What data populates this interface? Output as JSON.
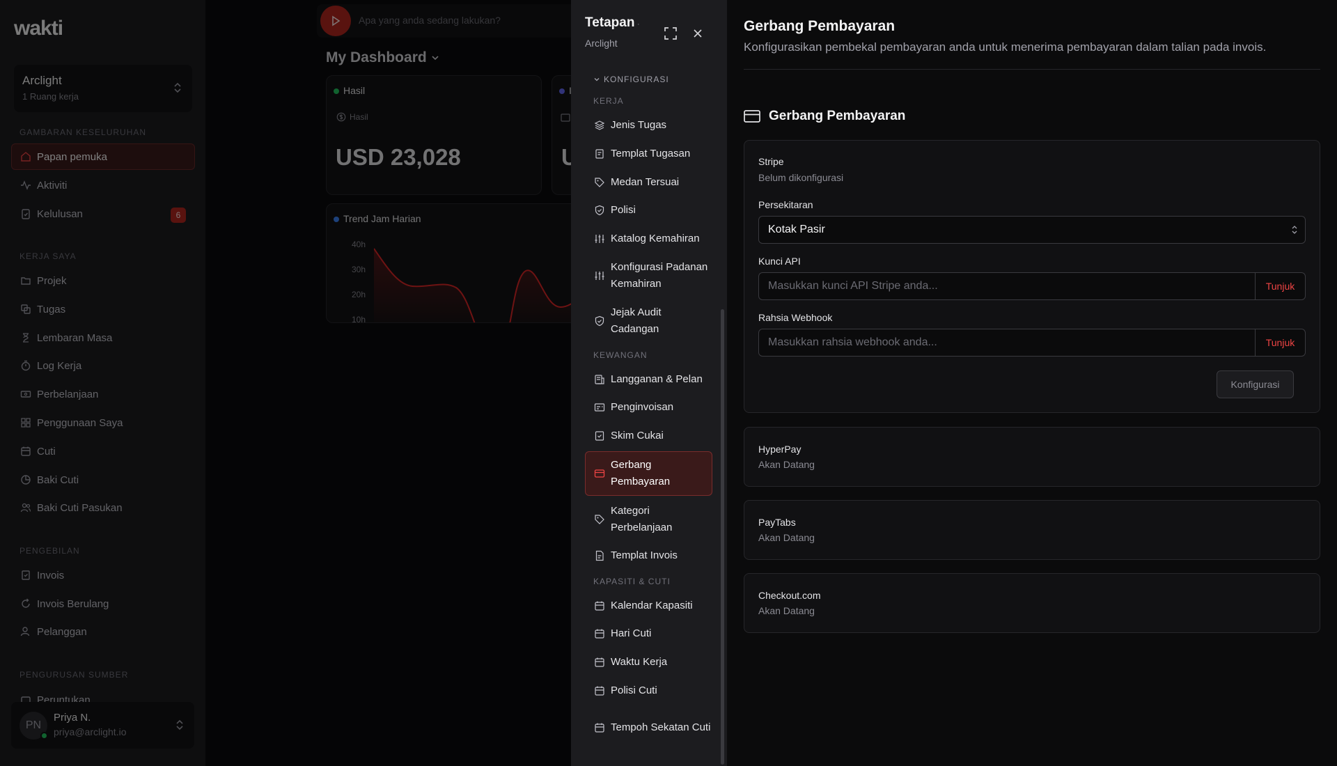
{
  "app": {
    "logo": "wakti"
  },
  "sidebar": {
    "workspace": {
      "name": "Arclight",
      "sub": "1 Ruang kerja"
    },
    "sections": [
      {
        "title": "GAMBARAN KESELURUHAN",
        "items": [
          {
            "label": "Papan pemuka",
            "icon": "home-icon",
            "active": true
          },
          {
            "label": "Aktiviti",
            "icon": "activity-icon"
          },
          {
            "label": "Kelulusan",
            "icon": "clipboard-check-icon",
            "badge": "6"
          }
        ]
      },
      {
        "title": "KERJA SAYA",
        "items": [
          {
            "label": "Projek",
            "icon": "folder-icon"
          },
          {
            "label": "Tugas",
            "icon": "tasks-icon"
          },
          {
            "label": "Lembaran Masa",
            "icon": "hourglass-icon"
          },
          {
            "label": "Log Kerja",
            "icon": "stopwatch-icon"
          },
          {
            "label": "Perbelanjaan",
            "icon": "banknote-icon"
          },
          {
            "label": "Penggunaan Saya",
            "icon": "grid-icon"
          },
          {
            "label": "Cuti",
            "icon": "calendar-icon"
          },
          {
            "label": "Baki Cuti",
            "icon": "pie-icon"
          },
          {
            "label": "Baki Cuti Pasukan",
            "icon": "users-icon"
          }
        ]
      },
      {
        "title": "PENGEBILAN",
        "items": [
          {
            "label": "Invois",
            "icon": "invoice-icon"
          },
          {
            "label": "Invois Berulang",
            "icon": "repeat-icon"
          },
          {
            "label": "Pelanggan",
            "icon": "user-icon"
          }
        ]
      },
      {
        "title": "PENGURUSAN SUMBER",
        "items": [
          {
            "label": "Peruntukan",
            "icon": "allocation-icon"
          }
        ]
      }
    ],
    "user": {
      "initials": "PN",
      "name": "Priya N.",
      "email": "priya@arclight.io"
    }
  },
  "dashboard": {
    "timer_placeholder": "Apa yang anda sedang lakukan?",
    "title": "My Dashboard",
    "revenue_card": {
      "title": "Hasil",
      "sub": "Hasil",
      "value": "USD 23,028"
    },
    "second_card": {
      "title": "I",
      "value": "U"
    },
    "trend_card": {
      "title": "Trend Jam Harian",
      "ticks": [
        "40h",
        "30h",
        "20h",
        "10h"
      ]
    }
  },
  "settings": {
    "title": "Tetapan",
    "subtitle": "Arclight",
    "config_label": "KONFIGURASI",
    "groups": [
      {
        "title": "KERJA",
        "items": [
          {
            "label": "Jenis Tugas",
            "icon": "layers-icon"
          },
          {
            "label": "Templat Tugasan",
            "icon": "template-icon"
          },
          {
            "label": "Medan Tersuai",
            "icon": "tag-icon"
          },
          {
            "label": "Polisi",
            "icon": "shield-icon"
          },
          {
            "label": "Katalog Kemahiran",
            "icon": "sliders-icon"
          },
          {
            "label": "Konfigurasi Padanan Kemahiran",
            "icon": "sliders-icon"
          },
          {
            "label": "Jejak Audit Cadangan",
            "icon": "shield-check-icon"
          }
        ]
      },
      {
        "title": "KEWANGAN",
        "items": [
          {
            "label": "Langganan & Pelan",
            "icon": "subscription-icon"
          },
          {
            "label": "Penginvoisan",
            "icon": "receipt-icon"
          },
          {
            "label": "Skim Cukai",
            "icon": "tax-icon"
          },
          {
            "label": "Gerbang Pembayaran",
            "icon": "credit-card-icon",
            "active": true
          },
          {
            "label": "Kategori Perbelanjaan",
            "icon": "tag-icon"
          },
          {
            "label": "Templat Invois",
            "icon": "file-icon"
          }
        ]
      },
      {
        "title": "KAPASITI & CUTI",
        "items": [
          {
            "label": "Kalendar Kapasiti",
            "icon": "calendar-icon"
          },
          {
            "label": "Hari Cuti",
            "icon": "calendar-icon"
          },
          {
            "label": "Waktu Kerja",
            "icon": "calendar-icon"
          },
          {
            "label": "Polisi Cuti",
            "icon": "calendar-icon"
          },
          {
            "label": "Tempoh Sekatan Cuti",
            "icon": "calendar-icon"
          }
        ]
      }
    ]
  },
  "main": {
    "title": "Gerbang Pembayaran",
    "description": "Konfigurasikan pembekal pembayaran anda untuk menerima pembayaran dalam talian pada invois.",
    "section_title": "Gerbang Pembayaran",
    "stripe": {
      "name": "Stripe",
      "status": "Belum dikonfigurasi",
      "env_label": "Persekitaran",
      "env_value": "Kotak Pasir",
      "api_label": "Kunci API",
      "api_placeholder": "Masukkan kunci API Stripe anda...",
      "webhook_label": "Rahsia Webhook",
      "webhook_placeholder": "Masukkan rahsia webhook anda...",
      "reveal_label": "Tunjuk",
      "configure_label": "Konfigurasi"
    },
    "gateways": [
      {
        "name": "HyperPay",
        "status": "Akan Datang"
      },
      {
        "name": "PayTabs",
        "status": "Akan Datang"
      },
      {
        "name": "Checkout.com",
        "status": "Akan Datang"
      }
    ]
  },
  "colors": {
    "accent": "#b3261e",
    "link": "#ef4444",
    "success": "#22c55e"
  }
}
